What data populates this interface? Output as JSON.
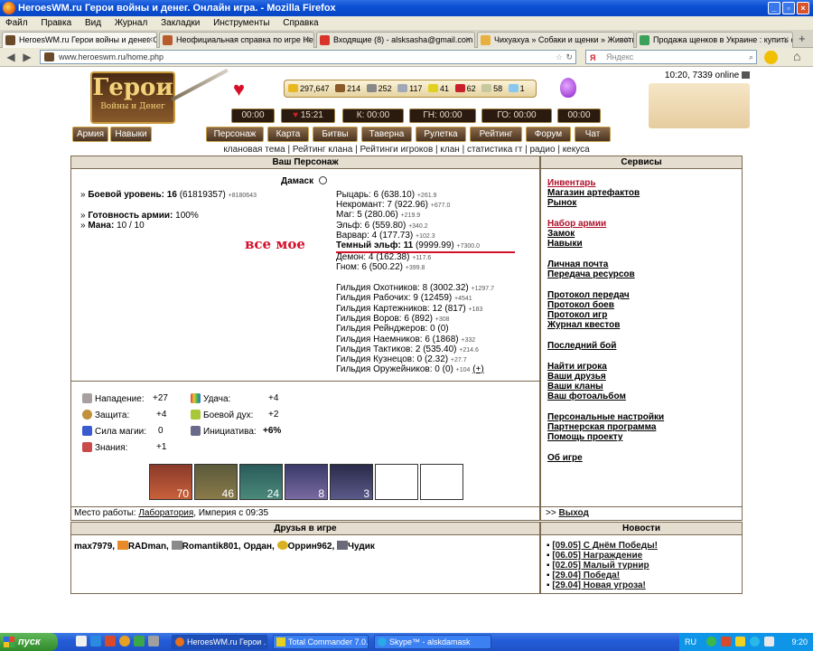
{
  "window": {
    "title": "HeroesWM.ru Герои войны и денег. Онлайн игра. - Mozilla Firefox"
  },
  "menu": [
    "Файл",
    "Правка",
    "Вид",
    "Журнал",
    "Закладки",
    "Инструменты",
    "Справка"
  ],
  "tabs": [
    {
      "label": "HeroesWM.ru Герои войны и денег. Он...",
      "active": true
    },
    {
      "label": "Неофициальная справка по игре Heroe..."
    },
    {
      "label": "Входящие (8) - alsksasha@gmail.com - ..."
    },
    {
      "label": "Чихуахуа » Собаки и щенки » Животн..."
    },
    {
      "label": "Продажа щенков в Украине : купить с..."
    }
  ],
  "nav": {
    "url": "www.heroeswm.ru/home.php",
    "search_placeholder": "Яндекс"
  },
  "header": {
    "logo_title": "Герои",
    "logo_subtitle": "Войны и Денег",
    "online": "10:20, 7339 online",
    "resources": [
      "297,647",
      "214",
      "252",
      "117",
      "41",
      "62",
      "58",
      "1"
    ],
    "timers": [
      "00:00",
      "15:21",
      "К: 00:00",
      "ГН: 00:00",
      "ГО: 00:00",
      "00:00"
    ],
    "left_nav": [
      "Армия",
      "Навыки"
    ],
    "main_nav": [
      "Персонаж",
      "Карта",
      "Битвы",
      "Таверна",
      "Рулетка",
      "Рейтинг",
      "Форум",
      "Чат"
    ],
    "sub_links": "клановая тема | Рейтинг клана | Рейтинги игроков | клан | статистика гт | радио | кекуса"
  },
  "character": {
    "header": "Ваш Персонаж",
    "name": "Дамаск",
    "combat_level_label": "Боевой уровень:",
    "combat_level": "16",
    "combat_exp": "(61819357)",
    "combat_exp_delta": "+8180643",
    "army_ready_label": "Готовность армии:",
    "army_ready": "100%",
    "mana_label": "Мана:",
    "mana": "10 / 10",
    "annotation": "все мое",
    "factions": [
      {
        "text": "Рыцарь: 6 (638.10)",
        "delta": "+261.9"
      },
      {
        "text": "Некромант: 7 (922.96)",
        "delta": "+677.0"
      },
      {
        "text": "Маг: 5 (280.06)",
        "delta": "+219.9"
      },
      {
        "text": "Эльф: 6 (559.80)",
        "delta": "+340.2"
      },
      {
        "text": "Варвар: 4 (177.73)",
        "delta": "+102.3"
      },
      {
        "text": "Темный эльф: 11",
        "value": "(9999.99)",
        "delta": "+7300.0"
      },
      {
        "text": "Демон: 4 (162.38)",
        "delta": "+117.6"
      },
      {
        "text": "Гном: 6 (500.22)",
        "delta": "+399.8"
      }
    ],
    "guilds": [
      {
        "text": "Гильдия Охотников: 8 (3002.32)",
        "delta": "+1297.7"
      },
      {
        "text": "Гильдия Рабочих: 9 (12459)",
        "delta": "+4541"
      },
      {
        "text": "Гильдия Картежников: 12 (817)",
        "delta": "+183"
      },
      {
        "text": "Гильдия Воров: 6 (892)",
        "delta": "+308"
      },
      {
        "text": "Гильдия Рейнджеров: 0 (0)",
        "delta": ""
      },
      {
        "text": "Гильдия Наемников: 6 (1868)",
        "delta": "+332"
      },
      {
        "text": "Гильдия Тактиков: 2 (535.40)",
        "delta": "+214.6"
      },
      {
        "text": "Гильдия Кузнецов: 0 (2.32)",
        "delta": "+27.7"
      },
      {
        "text": "Гильдия Оружейников: 0 (0)",
        "delta": "+104",
        "extra": "(+)"
      }
    ],
    "stats": [
      {
        "label": "Нападение:",
        "value": "+27"
      },
      {
        "label": "Защита:",
        "value": "+4"
      },
      {
        "label": "Сила магии:",
        "value": "0"
      },
      {
        "label": "Знания:",
        "value": "+1"
      },
      {
        "label": "Удача:",
        "value": "+4"
      },
      {
        "label": "Боевой дух:",
        "value": "+2"
      },
      {
        "label": "Инициатива:",
        "value": "+6%"
      }
    ],
    "army_counts": [
      "70",
      "46",
      "24",
      "8",
      "3",
      "",
      ""
    ],
    "work_label": "Место работы:",
    "work_place": "Лаборатория",
    "work_suffix": ", Империя с 09:35"
  },
  "services": {
    "header": "Сервисы",
    "groups": [
      [
        "Инвентарь",
        "Магазин артефактов",
        "Рынок"
      ],
      [
        "Набор армии",
        "Замок",
        "Навыки"
      ],
      [
        "Личная почта",
        "Передача ресурсов"
      ],
      [
        "Протокол передач",
        "Протокол боев",
        "Протокол игр",
        "Журнал квестов"
      ],
      [
        "Последний бой"
      ],
      [
        "Найти игрока",
        "Ваши друзья",
        "Ваши кланы",
        "Ваш фотоальбом"
      ],
      [
        "Персональные настройки",
        "Партнерская программа",
        "Помощь проекту"
      ],
      [
        "Об игре"
      ]
    ],
    "exit_prefix": ">>",
    "exit_label": "Выход"
  },
  "friends": {
    "header": "Друзья в игре",
    "list": [
      "max7979,",
      "RADman,",
      "Romantik801,",
      "Ордан,",
      "Оррин962,",
      "Чудик"
    ]
  },
  "news": {
    "header": "Новости",
    "items": [
      "[09.05] С Днём Победы!",
      "[06.05] Награждение",
      "[02.05] Малый турнир",
      "[29.04] Победа!",
      "[29.04] Новая угроза!"
    ]
  },
  "taskbar": {
    "start": "пуск",
    "tasks": [
      "HeroesWM.ru Герои ...",
      "Total Commander 7.0...",
      "Skype™ - alskdamask"
    ],
    "lang": "RU",
    "clock": "9:20"
  }
}
